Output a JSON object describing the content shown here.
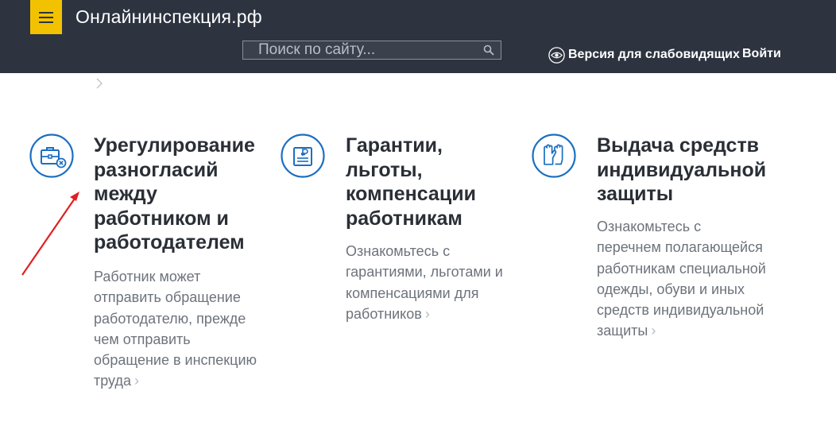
{
  "header": {
    "menu_icon": "hamburger-icon",
    "site_title": "Онлайнинспекция.рф",
    "search_placeholder": "Поиск по сайту...",
    "search_icon": "search-icon",
    "vision_icon": "eye-icon",
    "vision_label": "Версия для слабовидящих",
    "login_label": "Войти"
  },
  "colors": {
    "header_bg": "#2d3440",
    "accent": "#f2c200",
    "icon_blue": "#1b6fc0",
    "annotation_arrow": "#e02020"
  },
  "cards": [
    {
      "icon": "briefcase-icon",
      "title": "Урегулирование разногласий между работником и работодателем",
      "description": "Работник может отправить обращение работодателю, прежде чем отправить обращение в инспекцию труда"
    },
    {
      "icon": "ruble-document-icon",
      "title": "Гарантии, льготы, компенсации работникам",
      "description": "Ознакомьтесь с гарантиями, льготами и компенсациями для работников"
    },
    {
      "icon": "gloves-icon",
      "title": "Выдача средств индивидуальной защиты",
      "description": "Ознакомьтесь с перечнем полагающейся работникам специальной одежды, обуви и иных средств индивидуальной защиты"
    }
  ]
}
